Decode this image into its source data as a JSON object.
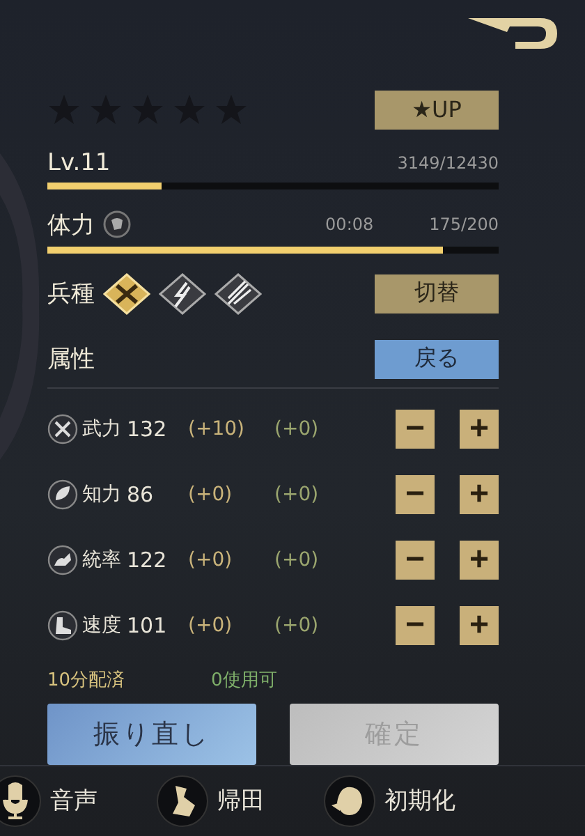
{
  "star_slots": [
    {
      "filled": false
    },
    {
      "filled": false
    },
    {
      "filled": false
    },
    {
      "filled": false
    },
    {
      "filled": false
    }
  ],
  "star_up_button": "★UP",
  "level": {
    "label": "Lv.11",
    "reading": "3149/12430",
    "level": 0.253
  },
  "stamina": {
    "label": "体力",
    "timer": "00:08",
    "reading": "175/200",
    "level": 0.875
  },
  "troop": {
    "label": "兵種",
    "types": [
      {
        "kind": "axe",
        "selected": true
      },
      {
        "kind": "bolt",
        "selected": false
      },
      {
        "kind": "arrow",
        "selected": false
      }
    ],
    "switch_button": "切替"
  },
  "attributes": {
    "title": "属性",
    "back_button": "戻る",
    "rows": [
      {
        "kind": "force",
        "name": "武力",
        "value": "132",
        "bonus": "(+10)",
        "added": "(+0)",
        "minus": "−",
        "plus": "+"
      },
      {
        "kind": "intellect",
        "name": "知力",
        "value": "86",
        "bonus": "(+0)",
        "added": "(+0)",
        "minus": "−",
        "plus": "+"
      },
      {
        "kind": "command",
        "name": "統率",
        "value": "122",
        "bonus": "(+0)",
        "added": "(+0)",
        "minus": "−",
        "plus": "+"
      },
      {
        "kind": "speed",
        "name": "速度",
        "value": "101",
        "bonus": "(+0)",
        "added": "(+0)",
        "minus": "−",
        "plus": "+"
      }
    ]
  },
  "allocated": "10分配済",
  "available": "0使用可",
  "reroll_button": {
    "label": "振り直し",
    "disabled": false
  },
  "confirm_button": {
    "label": "確定",
    "disabled": true
  },
  "bottom_bar": [
    {
      "kind": "mic",
      "label": "音声"
    },
    {
      "kind": "farmer",
      "label": "帰田"
    },
    {
      "kind": "reset",
      "label": "初期化"
    }
  ]
}
